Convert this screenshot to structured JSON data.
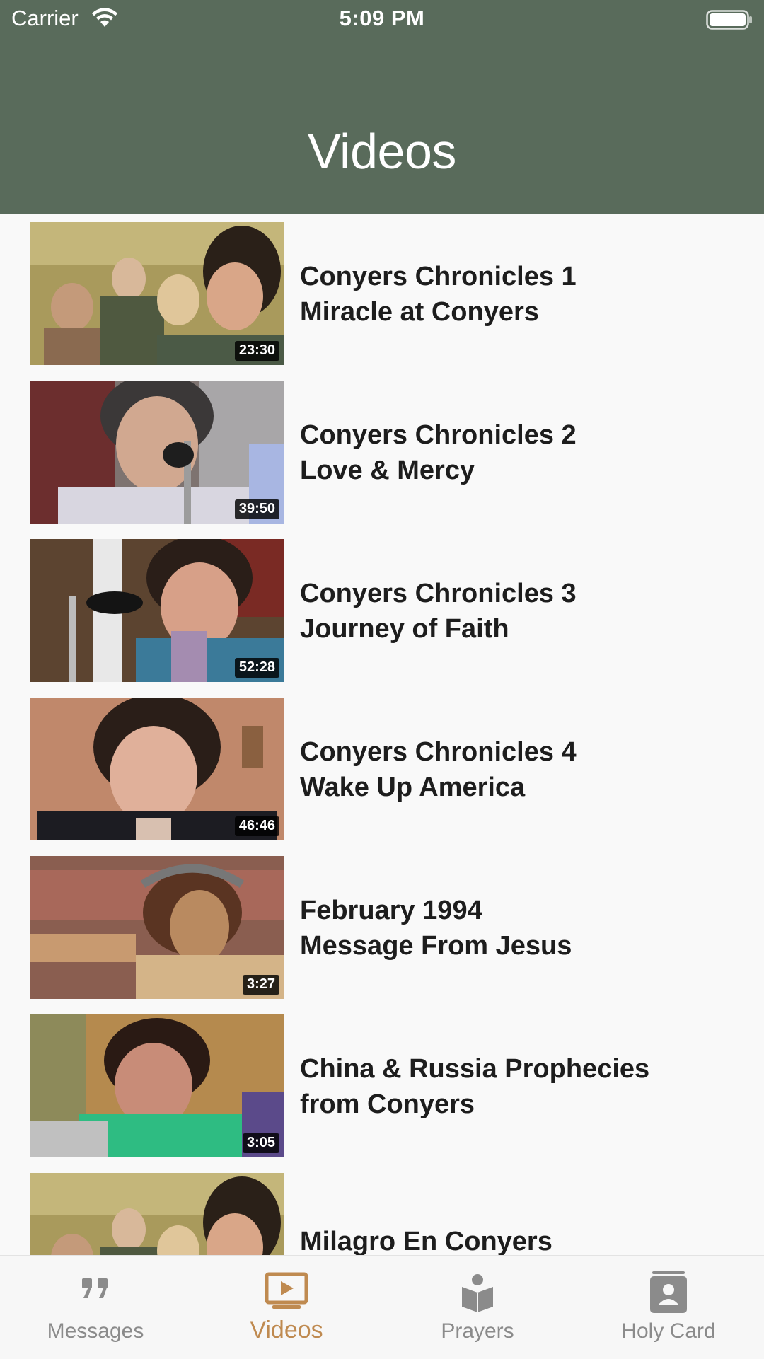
{
  "status_bar": {
    "carrier": "Carrier",
    "time": "5:09 PM"
  },
  "nav": {
    "title": "Videos"
  },
  "videos": [
    {
      "line1": "Conyers Chronicles 1",
      "line2": "Miracle at Conyers",
      "duration": "23:30"
    },
    {
      "line1": "Conyers Chronicles 2",
      "line2": "Love & Mercy",
      "duration": "39:50"
    },
    {
      "line1": "Conyers Chronicles 3",
      "line2": "Journey of Faith",
      "duration": "52:28"
    },
    {
      "line1": "Conyers Chronicles 4",
      "line2": "Wake Up America",
      "duration": "46:46"
    },
    {
      "line1": "February 1994",
      "line2": "Message From Jesus",
      "duration": "3:27"
    },
    {
      "line1": "China & Russia Prophecies",
      "line2": "from Conyers",
      "duration": "3:05"
    },
    {
      "line1": "Milagro En Conyers",
      "line2": "",
      "duration": ""
    }
  ],
  "tabs": [
    {
      "label": "Messages",
      "icon": "quote-icon",
      "active": false
    },
    {
      "label": "Videos",
      "icon": "video-player-icon",
      "active": true
    },
    {
      "label": "Prayers",
      "icon": "book-reader-icon",
      "active": false
    },
    {
      "label": "Holy Card",
      "icon": "contact-card-icon",
      "active": false
    }
  ],
  "colors": {
    "header": "#596b5b",
    "active_tab": "#bf8a50",
    "inactive_tab": "#8b8b8b"
  }
}
